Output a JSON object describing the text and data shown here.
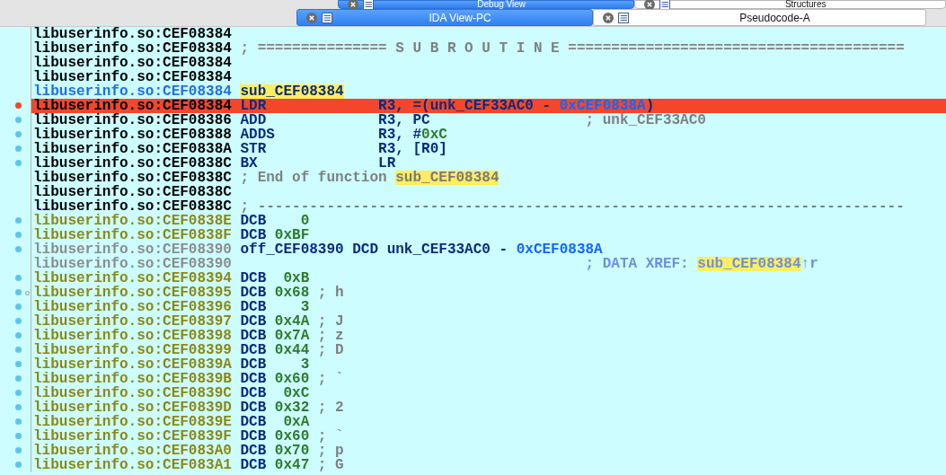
{
  "tab_bars": [
    {
      "tabs": [
        {
          "label": "Debug View",
          "selected": true
        },
        {
          "label": "Structures",
          "selected": false
        }
      ]
    },
    {
      "tabs": [
        {
          "label": "IDA View-PC",
          "selected": true
        },
        {
          "label": "Pseudocode-A",
          "selected": false
        }
      ]
    }
  ],
  "rows": [
    {
      "address": {
        "text": "libuserinfo.so:CEF08384",
        "kind": "code"
      },
      "dot": false,
      "breakpoint": false,
      "ring": false,
      "current": false,
      "kind": "blank"
    },
    {
      "address": {
        "text": "libuserinfo.so:CEF08384",
        "kind": "code"
      },
      "dot": false,
      "breakpoint": false,
      "ring": false,
      "current": false,
      "kind": "line",
      "tokens": [
        {
          "text": "; =============== S U B R O U T I N E =======================================",
          "kind": "comment"
        }
      ]
    },
    {
      "address": {
        "text": "libuserinfo.so:CEF08384",
        "kind": "code"
      },
      "dot": false,
      "breakpoint": false,
      "ring": false,
      "current": false,
      "kind": "blank"
    },
    {
      "address": {
        "text": "libuserinfo.so:CEF08384",
        "kind": "code"
      },
      "dot": false,
      "breakpoint": false,
      "ring": false,
      "current": false,
      "kind": "blank"
    },
    {
      "address": {
        "text": "libuserinfo.so:CEF08384",
        "kind": "function"
      },
      "dot": false,
      "breakpoint": false,
      "ring": false,
      "current": false,
      "kind": "line",
      "tokens": [
        {
          "text": "sub_CEF08384",
          "kind": "label-name"
        }
      ]
    },
    {
      "address": {
        "text": "libuserinfo.so:CEF08384",
        "kind": "code"
      },
      "dot": false,
      "breakpoint": true,
      "ring": false,
      "current": true,
      "kind": "insn",
      "mnemonic": "LDR",
      "operands": [
        {
          "text": "R3, =(unk_CEF33AC0 - ",
          "kind": "text"
        },
        {
          "text": "0xCEF0838A",
          "kind": "address"
        },
        {
          "text": ")",
          "kind": "text"
        }
      ]
    },
    {
      "address": {
        "text": "libuserinfo.so:CEF08386",
        "kind": "code"
      },
      "dot": true,
      "breakpoint": false,
      "ring": false,
      "current": false,
      "kind": "insn",
      "mnemonic": "ADD",
      "operands": [
        {
          "text": "R3, PC",
          "kind": "text"
        }
      ],
      "comment": [
        {
          "text": "; unk_CEF33AC0",
          "kind": "comment"
        }
      ]
    },
    {
      "address": {
        "text": "libuserinfo.so:CEF08388",
        "kind": "code"
      },
      "dot": true,
      "breakpoint": false,
      "ring": false,
      "current": false,
      "kind": "insn",
      "mnemonic": "ADDS",
      "operands": [
        {
          "text": "R3, #",
          "kind": "text"
        },
        {
          "text": "0xC",
          "kind": "number"
        }
      ]
    },
    {
      "address": {
        "text": "libuserinfo.so:CEF0838A",
        "kind": "code"
      },
      "dot": true,
      "breakpoint": false,
      "ring": false,
      "current": false,
      "kind": "insn",
      "mnemonic": "STR",
      "operands": [
        {
          "text": "R3, [R0]",
          "kind": "text"
        }
      ]
    },
    {
      "address": {
        "text": "libuserinfo.so:CEF0838C",
        "kind": "code"
      },
      "dot": true,
      "breakpoint": false,
      "ring": false,
      "current": false,
      "kind": "insn",
      "mnemonic": "BX",
      "operands": [
        {
          "text": "LR",
          "kind": "text"
        }
      ]
    },
    {
      "address": {
        "text": "libuserinfo.so:CEF0838C",
        "kind": "code"
      },
      "dot": false,
      "breakpoint": false,
      "ring": false,
      "current": false,
      "kind": "line",
      "tokens": [
        {
          "text": "; End of function ",
          "kind": "comment"
        },
        {
          "text": "sub_CEF08384",
          "kind": "comment-name"
        }
      ]
    },
    {
      "address": {
        "text": "libuserinfo.so:CEF0838C",
        "kind": "code"
      },
      "dot": false,
      "breakpoint": false,
      "ring": false,
      "current": false,
      "kind": "blank"
    },
    {
      "address": {
        "text": "libuserinfo.so:CEF0838C",
        "kind": "code"
      },
      "dot": false,
      "breakpoint": false,
      "ring": false,
      "current": false,
      "kind": "line",
      "tokens": [
        {
          "text": "; ---------------------------------------------------------------------------",
          "kind": "comment"
        }
      ]
    },
    {
      "address": {
        "text": "libuserinfo.so:CEF0838E",
        "kind": "data"
      },
      "dot": true,
      "breakpoint": false,
      "ring": false,
      "current": false,
      "kind": "dcb",
      "mnemonic": "DCB",
      "value": "0"
    },
    {
      "address": {
        "text": "libuserinfo.so:CEF0838F",
        "kind": "data"
      },
      "dot": true,
      "breakpoint": false,
      "ring": false,
      "current": false,
      "kind": "dcb",
      "mnemonic": "DCB",
      "value": "0xBF"
    },
    {
      "address": {
        "text": "libuserinfo.so:CEF08390",
        "kind": "loose"
      },
      "dot": true,
      "breakpoint": false,
      "ring": false,
      "current": false,
      "kind": "line",
      "tokens": [
        {
          "text": "off_CEF08390 DCD unk_CEF33AC0 - ",
          "kind": "text"
        },
        {
          "text": "0xCEF0838A",
          "kind": "address"
        }
      ]
    },
    {
      "address": {
        "text": "libuserinfo.so:CEF08390",
        "kind": "loose"
      },
      "dot": false,
      "breakpoint": false,
      "ring": false,
      "current": false,
      "kind": "far",
      "tokens": [
        {
          "text": "; DATA XREF: ",
          "kind": "xref"
        },
        {
          "text": "sub_CEF08384",
          "kind": "xref-name"
        },
        {
          "text": "↑r",
          "kind": "xref"
        }
      ]
    },
    {
      "address": {
        "text": "libuserinfo.so:CEF08394",
        "kind": "data"
      },
      "dot": true,
      "breakpoint": false,
      "ring": false,
      "current": false,
      "kind": "dcb",
      "mnemonic": "DCB",
      "value": "0xB"
    },
    {
      "address": {
        "text": "libuserinfo.so:CEF08395",
        "kind": "data"
      },
      "dot": true,
      "breakpoint": false,
      "ring": true,
      "current": false,
      "kind": "dcb",
      "mnemonic": "DCB",
      "value": "0x68",
      "comment": "; h"
    },
    {
      "address": {
        "text": "libuserinfo.so:CEF08396",
        "kind": "data"
      },
      "dot": true,
      "breakpoint": false,
      "ring": false,
      "current": false,
      "kind": "dcb",
      "mnemonic": "DCB",
      "value": "3"
    },
    {
      "address": {
        "text": "libuserinfo.so:CEF08397",
        "kind": "data"
      },
      "dot": true,
      "breakpoint": false,
      "ring": false,
      "current": false,
      "kind": "dcb",
      "mnemonic": "DCB",
      "value": "0x4A",
      "comment": "; J"
    },
    {
      "address": {
        "text": "libuserinfo.so:CEF08398",
        "kind": "data"
      },
      "dot": true,
      "breakpoint": false,
      "ring": false,
      "current": false,
      "kind": "dcb",
      "mnemonic": "DCB",
      "value": "0x7A",
      "comment": "; z"
    },
    {
      "address": {
        "text": "libuserinfo.so:CEF08399",
        "kind": "data"
      },
      "dot": true,
      "breakpoint": false,
      "ring": false,
      "current": false,
      "kind": "dcb",
      "mnemonic": "DCB",
      "value": "0x44",
      "comment": "; D"
    },
    {
      "address": {
        "text": "libuserinfo.so:CEF0839A",
        "kind": "data"
      },
      "dot": true,
      "breakpoint": false,
      "ring": false,
      "current": false,
      "kind": "dcb",
      "mnemonic": "DCB",
      "value": "3"
    },
    {
      "address": {
        "text": "libuserinfo.so:CEF0839B",
        "kind": "data"
      },
      "dot": true,
      "breakpoint": false,
      "ring": false,
      "current": false,
      "kind": "dcb",
      "mnemonic": "DCB",
      "value": "0x60",
      "comment": "; `"
    },
    {
      "address": {
        "text": "libuserinfo.so:CEF0839C",
        "kind": "data"
      },
      "dot": true,
      "breakpoint": false,
      "ring": false,
      "current": false,
      "kind": "dcb",
      "mnemonic": "DCB",
      "value": "0xC"
    },
    {
      "address": {
        "text": "libuserinfo.so:CEF0839D",
        "kind": "data"
      },
      "dot": true,
      "breakpoint": false,
      "ring": false,
      "current": false,
      "kind": "dcb",
      "mnemonic": "DCB",
      "value": "0x32",
      "comment": "; 2"
    },
    {
      "address": {
        "text": "libuserinfo.so:CEF0839E",
        "kind": "data"
      },
      "dot": true,
      "breakpoint": false,
      "ring": false,
      "current": false,
      "kind": "dcb",
      "mnemonic": "DCB",
      "value": "0xA"
    },
    {
      "address": {
        "text": "libuserinfo.so:CEF0839F",
        "kind": "data"
      },
      "dot": true,
      "breakpoint": false,
      "ring": false,
      "current": false,
      "kind": "dcb",
      "mnemonic": "DCB",
      "value": "0x60",
      "comment": "; `"
    },
    {
      "address": {
        "text": "libuserinfo.so:CEF083A0",
        "kind": "data"
      },
      "dot": true,
      "breakpoint": false,
      "ring": false,
      "current": false,
      "kind": "dcb",
      "mnemonic": "DCB",
      "value": "0x70",
      "comment": "; p"
    },
    {
      "address": {
        "text": "libuserinfo.so:CEF083A1",
        "kind": "data"
      },
      "dot": true,
      "breakpoint": false,
      "ring": false,
      "current": false,
      "kind": "dcb",
      "mnemonic": "DCB",
      "value": "0x47",
      "comment": "; G"
    }
  ]
}
